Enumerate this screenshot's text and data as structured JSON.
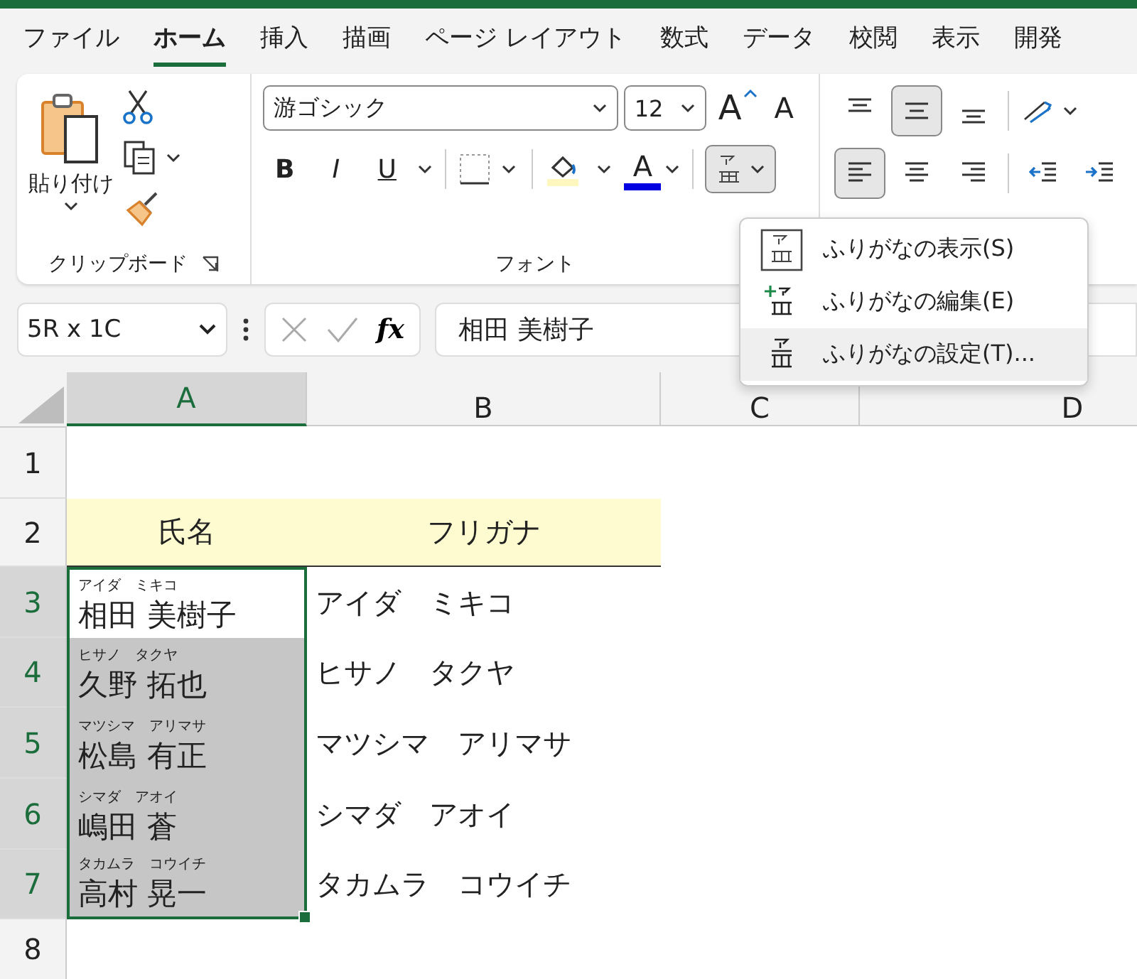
{
  "tabs": [
    {
      "label": "ファイル",
      "selected": false
    },
    {
      "label": "ホーム",
      "selected": true
    },
    {
      "label": "挿入",
      "selected": false
    },
    {
      "label": "描画",
      "selected": false
    },
    {
      "label": "ページ レイアウト",
      "selected": false
    },
    {
      "label": "数式",
      "selected": false
    },
    {
      "label": "データ",
      "selected": false
    },
    {
      "label": "校閲",
      "selected": false
    },
    {
      "label": "表示",
      "selected": false
    },
    {
      "label": "開発",
      "selected": false
    }
  ],
  "clipboard": {
    "paste_label": "貼り付け",
    "group_label": "クリップボード"
  },
  "font": {
    "font_name": "游ゴシック",
    "font_size": "12",
    "grow": "A",
    "shrink": "A",
    "bold": "B",
    "italic": "I",
    "underline": "U",
    "font_color": "A",
    "furigana_pressed": true,
    "group_label": "フォント"
  },
  "alignment": [
    {
      "kind": "top",
      "pressed": false
    },
    {
      "kind": "middle",
      "pressed": true
    },
    {
      "kind": "bottom",
      "pressed": false
    },
    {
      "kind": "orientation",
      "pressed": false
    },
    {
      "kind": "left",
      "pressed": true
    },
    {
      "kind": "center",
      "pressed": false
    },
    {
      "kind": "right",
      "pressed": false
    },
    {
      "kind": "outdent",
      "pressed": false
    },
    {
      "kind": "indent",
      "pressed": false
    }
  ],
  "furigana_menu": [
    {
      "kind": "show",
      "label": "ふりがなの表示(S)",
      "highlighted": false
    },
    {
      "kind": "edit",
      "label": "ふりがなの編集(E)",
      "highlighted": false
    },
    {
      "kind": "settings",
      "label": "ふりがなの設定(T)...",
      "highlighted": true
    }
  ],
  "formula_bar": {
    "name_box": "5R x 1C",
    "function_button": "fx",
    "formula": "相田 美樹子"
  },
  "columns": [
    {
      "label": "A",
      "selected": true
    },
    {
      "label": "B",
      "selected": false
    },
    {
      "label": "C",
      "selected": false
    },
    {
      "label": "D",
      "selected": false
    }
  ],
  "rows": [
    {
      "number": "1",
      "selected": false
    },
    {
      "number": "2",
      "selected": false,
      "cells": [
        {
          "kind": "header",
          "text": "氏名"
        },
        {
          "kind": "header",
          "text": "フリガナ"
        }
      ]
    },
    {
      "number": "3",
      "selected": true,
      "cells": [
        {
          "kind": "ruby",
          "reading": "アイダ　ミキコ",
          "text": "相田 美樹子",
          "active": true
        },
        {
          "kind": "plain",
          "text": "アイダ　ミキコ"
        }
      ]
    },
    {
      "number": "4",
      "selected": true,
      "cells": [
        {
          "kind": "ruby",
          "reading": "ヒサノ　タクヤ",
          "text": "久野 拓也",
          "active": false
        },
        {
          "kind": "plain",
          "text": "ヒサノ　タクヤ"
        }
      ]
    },
    {
      "number": "5",
      "selected": true,
      "cells": [
        {
          "kind": "ruby",
          "reading": "マツシマ　アリマサ",
          "text": "松島 有正",
          "active": false
        },
        {
          "kind": "plain",
          "text": "マツシマ　アリマサ"
        }
      ]
    },
    {
      "number": "6",
      "selected": true,
      "cells": [
        {
          "kind": "ruby",
          "reading": "シマダ　アオイ",
          "text": "嶋田 蒼",
          "active": false
        },
        {
          "kind": "plain",
          "text": "シマダ　アオイ"
        }
      ]
    },
    {
      "number": "7",
      "selected": true,
      "cells": [
        {
          "kind": "ruby",
          "reading": "タカムラ　コウイチ",
          "text": "高村 晃一",
          "active": false
        },
        {
          "kind": "plain",
          "text": "タカムラ　コウイチ"
        }
      ]
    },
    {
      "number": "8",
      "selected": false
    }
  ]
}
